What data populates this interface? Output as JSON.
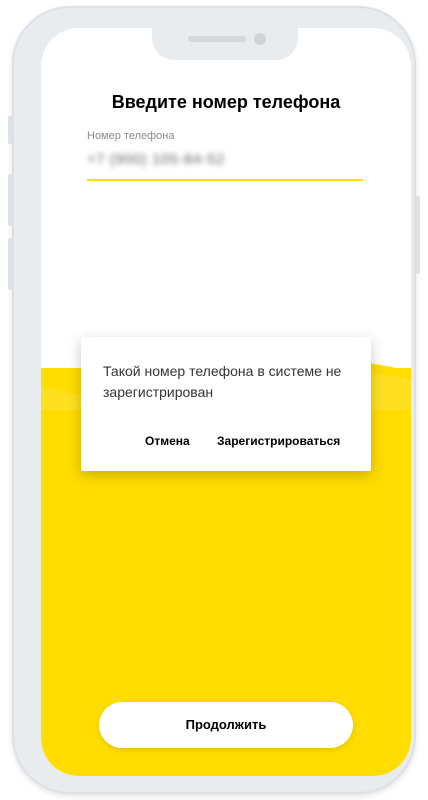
{
  "screen": {
    "title": "Введите номер телефона",
    "phone_field": {
      "label": "Номер телефона",
      "value": "+7 (900) 105-84-52"
    },
    "dialog": {
      "message": "Такой номер телефона в системе не зарегистрирован",
      "cancel_label": "Отмена",
      "register_label": "Зарегистрироваться"
    },
    "continue_label": "Продолжить"
  },
  "colors": {
    "accent_yellow": "#ffdd00",
    "device_frame": "#e9ecef"
  }
}
